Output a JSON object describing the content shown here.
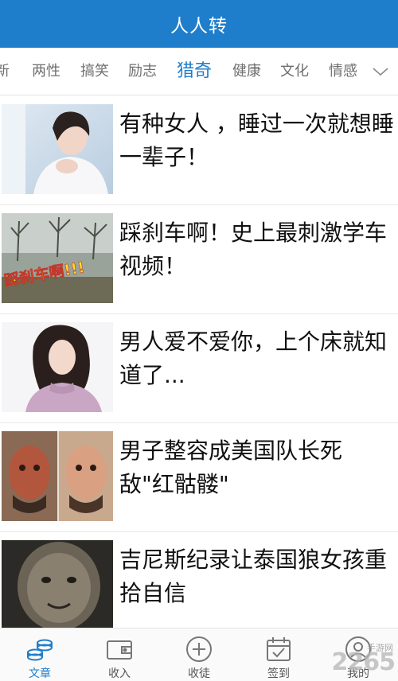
{
  "app": {
    "title": "人人转"
  },
  "tabs": [
    {
      "label": "新"
    },
    {
      "label": "两性"
    },
    {
      "label": "搞笑"
    },
    {
      "label": "励志"
    },
    {
      "label": "猎奇",
      "active": true
    },
    {
      "label": "健康"
    },
    {
      "label": "文化"
    },
    {
      "label": "情感"
    }
  ],
  "tabs_more_icon": "chevron-down-icon",
  "articles": [
    {
      "title": "有种女人 ，睡过一次就想睡一辈子！",
      "thumbnail": "woman-in-white-photo"
    },
    {
      "title": "踩刹车啊！史上最刺激学车视频！",
      "thumbnail": "driving-video-still",
      "thumbnail_caption": "踩刹车啊!!!"
    },
    {
      "title": "男人爱不爱你，上个床就知道了...",
      "thumbnail": "woman-in-sweater-photo"
    },
    {
      "title": "男子整容成美国队长死敌\"红骷髅\"",
      "thumbnail": "man-face-collage-photo"
    },
    {
      "title": "吉尼斯纪录让泰国狼女孩重拾自信",
      "thumbnail": "hairy-face-photo"
    }
  ],
  "bottom_nav": [
    {
      "label": "文章",
      "icon": "coins-icon",
      "active": true
    },
    {
      "label": "收入",
      "icon": "wallet-icon"
    },
    {
      "label": "收徒",
      "icon": "plus-circle-icon"
    },
    {
      "label": "签到",
      "icon": "calendar-check-icon"
    },
    {
      "label": "我的",
      "icon": "user-icon"
    }
  ],
  "watermark": {
    "text": "2265",
    "small": "手游网"
  },
  "colors": {
    "primary": "#1f7ecb",
    "tab_inactive": "#6f6f6f",
    "title_text": "#111111"
  }
}
